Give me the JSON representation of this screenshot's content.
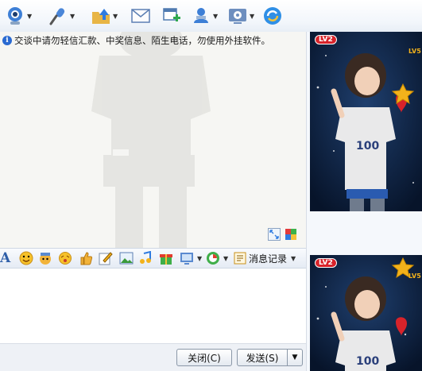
{
  "toolbar": {
    "items": [
      {
        "name": "video-call",
        "has_menu": true
      },
      {
        "name": "voice-call",
        "has_menu": true
      },
      {
        "name": "send-file",
        "has_menu": true
      },
      {
        "name": "send-mail",
        "has_menu": false
      },
      {
        "name": "add-app",
        "has_menu": false
      },
      {
        "name": "remote-assist",
        "has_menu": true
      },
      {
        "name": "settings",
        "has_menu": true
      },
      {
        "name": "refresh",
        "has_menu": false
      }
    ]
  },
  "chat": {
    "notice": "交谈中请勿轻信汇款、中奖信息、陌生电话，勿使用外挂软件。"
  },
  "input_toolbar": {
    "history_label": "消息记录"
  },
  "buttons": {
    "close": "关闭(C)",
    "send": "发送(S)"
  },
  "profile": {
    "level_badge": "LV2",
    "star_level": "LV5",
    "shirt_text": "100"
  },
  "colors": {
    "toolbar_bg": "#eef3f9",
    "accent_blue": "#2a6ad1",
    "photo_bg": "#0b1d3a",
    "heart_red": "#d8232a",
    "star_gold": "#f3b21b"
  }
}
